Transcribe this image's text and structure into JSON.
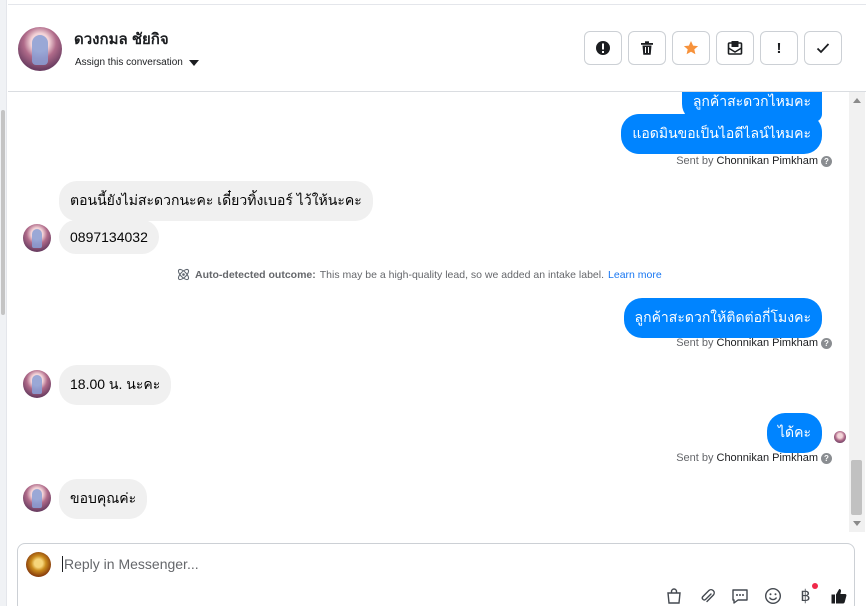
{
  "header": {
    "contact_name": "ดวงกมล ชัยกิจ",
    "assign_label": "Assign this conversation",
    "actions": [
      {
        "name": "spam-icon",
        "label": "!"
      },
      {
        "name": "trash-icon",
        "label": ""
      },
      {
        "name": "star-icon",
        "label": ""
      },
      {
        "name": "mark-unread-icon",
        "label": ""
      },
      {
        "name": "follow-up-icon",
        "label": "!"
      },
      {
        "name": "check-icon",
        "label": ""
      }
    ]
  },
  "messages": {
    "out_1_partial": "ลูกค้าสะดวกไหมคะ",
    "out_2": "แอดมินขอเป็นไอดีไลน์ไหมคะ",
    "sent_by_prefix": "Sent by",
    "sent_by_name": "Chonnikan Pimkham",
    "in_1": "ตอนนี้ยังไม่สะดวกนะคะ เดี๋ยวทิ้งเบอร์ ไว้ให้นะคะ",
    "in_2": "0897134032",
    "outcome_label": "Auto-detected outcome:",
    "outcome_text": "This may be a high-quality lead, so we added an intake label.",
    "outcome_link": "Learn more",
    "out_3": "ลูกค้าสะดวกให้ติดต่อกี่โมงคะ",
    "in_3": "18.00 น. นะคะ",
    "out_4": "ได้คะ",
    "in_4": "ขอบคุณค่ะ"
  },
  "composer": {
    "placeholder": "Reply in Messenger...",
    "tools": [
      "shopping-bag-icon",
      "attachment-icon",
      "saved-reply-icon",
      "emoji-icon",
      "baht-icon",
      "like-icon"
    ]
  },
  "colors": {
    "accent": "#0084ff",
    "incoming_bubble": "#f0f0f0",
    "star": "#f7923b",
    "link": "#1877f2"
  }
}
